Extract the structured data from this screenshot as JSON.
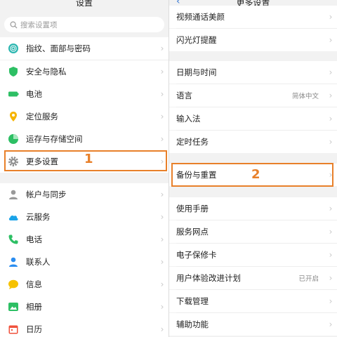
{
  "left": {
    "title": "设置",
    "search_placeholder": "搜索设置项",
    "items": [
      {
        "label": "指纹、面部与密码",
        "icon": "fingerprint-icon",
        "color": "#2bb6b0"
      },
      {
        "label": "安全与隐私",
        "icon": "shield-icon",
        "color": "#2dbf64"
      },
      {
        "label": "电池",
        "icon": "battery-icon",
        "color": "#2dbf64"
      },
      {
        "label": "定位服务",
        "icon": "location-pin-icon",
        "color": "#f6b400"
      },
      {
        "label": "运存与存储空间",
        "icon": "storage-pie-icon",
        "color": "#2dbf64"
      },
      {
        "label": "更多设置",
        "icon": "gear-icon",
        "color": "#8e8e8e"
      },
      {
        "label": "帐户与同步",
        "icon": "account-sync-icon",
        "color": "#9a9a9a"
      },
      {
        "label": "云服务",
        "icon": "cloud-icon",
        "color": "#1aa3e8"
      },
      {
        "label": "电话",
        "icon": "phone-icon",
        "color": "#2dbf64"
      },
      {
        "label": "联系人",
        "icon": "contact-icon",
        "color": "#2a8df0"
      },
      {
        "label": "信息",
        "icon": "message-icon",
        "color": "#f6c200"
      },
      {
        "label": "相册",
        "icon": "album-icon",
        "color": "#2dbf64"
      },
      {
        "label": "日历",
        "icon": "calendar-icon",
        "color": "#f0523c"
      }
    ],
    "annotation": "1"
  },
  "right": {
    "title": "更多设置",
    "items": [
      {
        "label": "视频通话美颜",
        "value": ""
      },
      {
        "label": "闪光灯提醒",
        "value": ""
      },
      {
        "label": "日期与时间",
        "value": ""
      },
      {
        "label": "语言",
        "value": "简体中文"
      },
      {
        "label": "输入法",
        "value": ""
      },
      {
        "label": "定时任务",
        "value": ""
      },
      {
        "label": "备份与重置",
        "value": ""
      },
      {
        "label": "使用手册",
        "value": ""
      },
      {
        "label": "服务网点",
        "value": ""
      },
      {
        "label": "电子保修卡",
        "value": ""
      },
      {
        "label": "用户体验改进计划",
        "value": "已开启"
      },
      {
        "label": "下载管理",
        "value": ""
      },
      {
        "label": "辅助功能",
        "value": ""
      }
    ],
    "annotation": "2"
  },
  "colors": {
    "accent": "#e8802a",
    "back_arrow": "#3a7bd5"
  }
}
